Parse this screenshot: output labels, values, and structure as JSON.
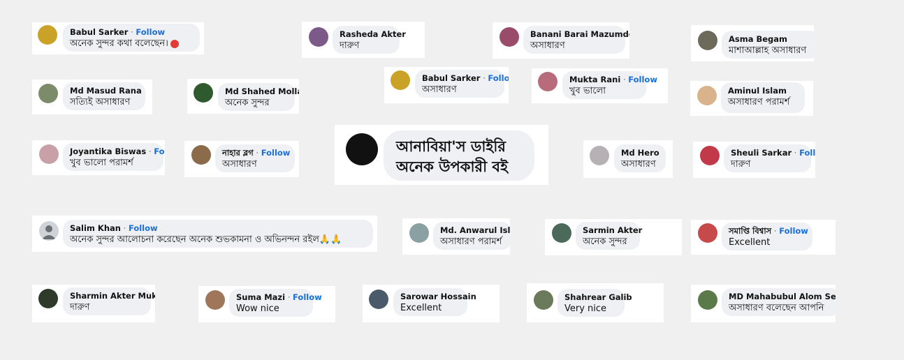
{
  "follow_label": "Follow",
  "comments": [
    {
      "name": "Babul Sarker",
      "follow": true,
      "text": "অনেক সুন্দর কথা বলেছেন।",
      "emoji": "tomato"
    },
    {
      "name": "Rasheda Akter",
      "follow": false,
      "text": "দারুণ"
    },
    {
      "name": "Banani Barai Mazumder",
      "follow": false,
      "text": "অসাধারণ"
    },
    {
      "name": "Asma Begam",
      "follow": false,
      "text": "মাশাআল্লাহ অসাধারণ"
    },
    {
      "name": "Babul Sarker",
      "follow": true,
      "text": "অসাধারণ"
    },
    {
      "name": "Mukta Rani",
      "follow": true,
      "text": "খুব ভালো"
    },
    {
      "name": "Md Masud Rana",
      "follow": false,
      "text": "সত্যিই অসাধারণ"
    },
    {
      "name": "Md Shahed Molla",
      "follow": false,
      "text": "অনেক সুন্দর"
    },
    {
      "name": "Aminul Islam",
      "follow": false,
      "text": "অসাধারণ পরামর্শ"
    },
    {
      "name": "Joyantika Biswas",
      "follow": true,
      "text": "খুব ভালো পরামর্শ"
    },
    {
      "name": "নাহার ব্লগ",
      "follow": true,
      "text": "অসাধারণ"
    },
    {
      "name": "Md Hero",
      "follow": false,
      "text": "অসাধারণ"
    },
    {
      "name": "Sheuli Sarkar",
      "follow": true,
      "text": "দারুণ"
    },
    {
      "name": "Salim Khan",
      "follow": true,
      "text": "অনেক সুন্দর আলোচনা করেছেন অনেক শুভকামনা ও অভিনন্দন রইল🙏🙏"
    },
    {
      "name": "Md. Anwarul Islam",
      "follow": false,
      "text": "অসাধারণ পরামর্শ"
    },
    {
      "name": "Sarmin Akter",
      "follow": false,
      "text": "অনেক সুন্দর"
    },
    {
      "name": "সমাপ্তি বিশ্বাস",
      "follow": true,
      "text": "Excellent"
    },
    {
      "name": "Sharmin Akter Mukta",
      "follow": false,
      "text": "দারুণ"
    },
    {
      "name": "Suma Mazi",
      "follow": true,
      "text": "Wow nice"
    },
    {
      "name": "Sarowar Hossain",
      "follow": false,
      "text": "Excellent"
    },
    {
      "name": "Shahrear Galib",
      "follow": false,
      "text": "Very nice"
    },
    {
      "name": "MD Mahabubul Alom Sentu",
      "follow": false,
      "text": "অসাধারণ বলেছেন আপনি"
    }
  ],
  "featured": {
    "line1": "আনাবিয়া'স ডাইরি",
    "line2": "অনেক উপকারী বই"
  }
}
